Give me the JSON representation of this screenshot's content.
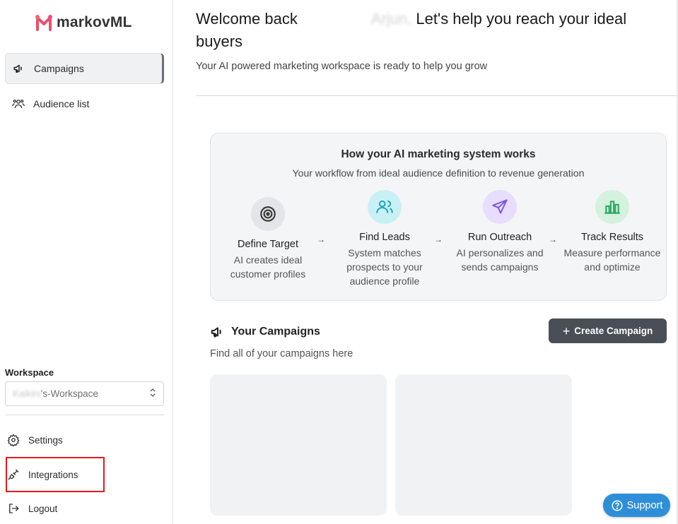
{
  "brand": {
    "name": "markovML"
  },
  "sidebar": {
    "nav": [
      {
        "label": "Campaigns",
        "icon": "megaphone-icon",
        "active": true
      },
      {
        "label": "Audience list",
        "icon": "users-icon",
        "active": false
      }
    ],
    "workspace": {
      "label": "Workspace",
      "value_prefix": "Kaikini",
      "value_suffix": "'s-Workspace"
    },
    "bottom": [
      {
        "label": "Settings",
        "icon": "gear-icon"
      },
      {
        "label": "Integrations",
        "icon": "plug-icon"
      },
      {
        "label": "Logout",
        "icon": "logout-icon"
      }
    ]
  },
  "header": {
    "welcome_prefix": "Welcome back",
    "welcome_name": "Arjun,",
    "welcome_suffix": "Let's help you reach your ideal buyers",
    "subtitle": "Your AI powered marketing workspace is ready to help you grow"
  },
  "how_it_works": {
    "title": "How your AI marketing system works",
    "subtitle": "Your workflow from ideal audience definition to revenue generation",
    "steps": [
      {
        "name": "Define Target",
        "desc": "AI creates ideal customer profiles",
        "icon": "target-icon",
        "color": "#e4e5e8"
      },
      {
        "name": "Find Leads",
        "desc": "System matches prospects to your audience profile",
        "icon": "users-icon",
        "color": "#c9f1f5"
      },
      {
        "name": "Run Outreach",
        "desc": "AI personalizes and sends campaigns",
        "icon": "send-icon",
        "color": "#e7defd"
      },
      {
        "name": "Track Results",
        "desc": "Measure performance and optimize",
        "icon": "bar-chart-icon",
        "color": "#d4f2de"
      }
    ],
    "arrow": "→"
  },
  "campaigns": {
    "title": "Your Campaigns",
    "subtitle": "Find all of your campaigns here",
    "create_label": "Create Campaign"
  },
  "support": {
    "label": "Support"
  }
}
